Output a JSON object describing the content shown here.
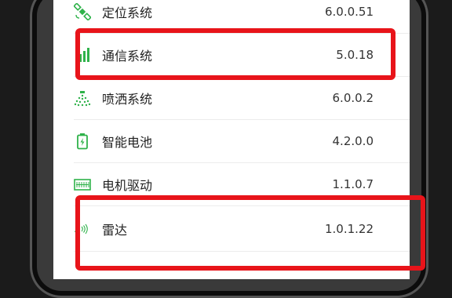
{
  "settings_list": {
    "items": [
      {
        "label": "定位系统",
        "version": "6.0.0.51",
        "icon": "satellite-icon",
        "highlighted": false
      },
      {
        "label": "通信系统",
        "version": "5.0.18",
        "icon": "signal-bars-icon",
        "highlighted": true
      },
      {
        "label": "喷洒系统",
        "version": "6.0.0.2",
        "icon": "spray-icon",
        "highlighted": false
      },
      {
        "label": "智能电池",
        "version": "4.2.0.0",
        "icon": "battery-icon",
        "highlighted": false
      },
      {
        "label": "电机驱动",
        "version": "1.1.0.7",
        "icon": "motor-driver-icon",
        "highlighted": false
      },
      {
        "label": "雷达",
        "version": "1.0.1.22",
        "icon": "radar-icon",
        "highlighted": true
      }
    ]
  },
  "colors": {
    "accent_green": "#2fb24a",
    "highlight_red": "#e8141a",
    "divider": "#ececec"
  }
}
